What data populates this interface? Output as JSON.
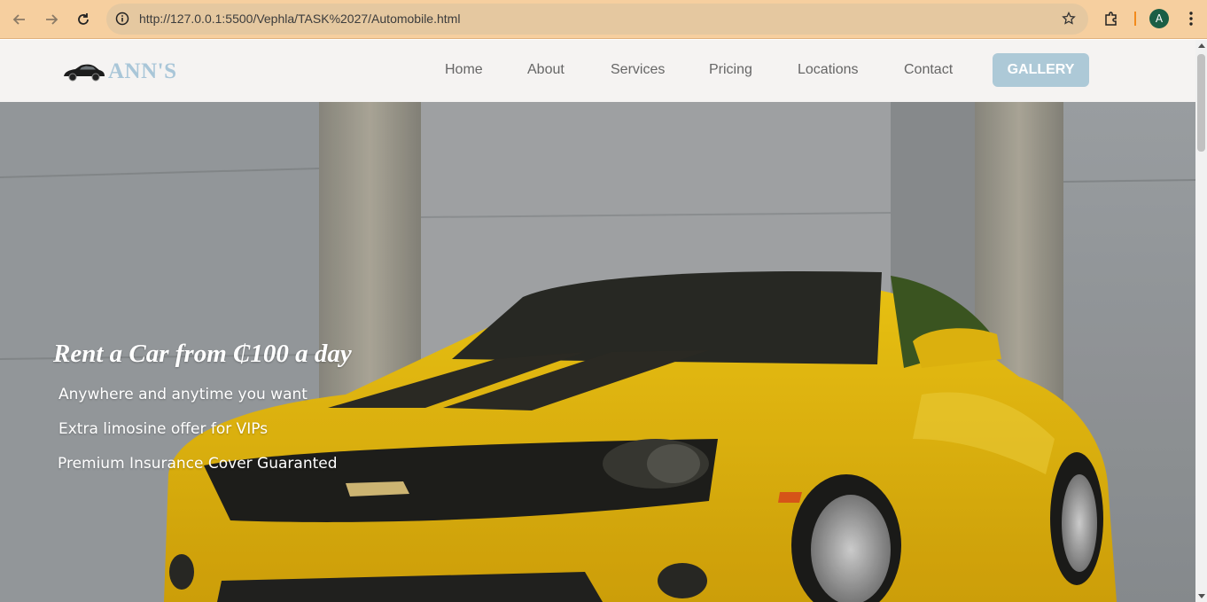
{
  "browser": {
    "url": "http://127.0.0.1:5500/Vephla/TASK%2027/Automobile.html",
    "profile_initial": "A",
    "icons": [
      "back-icon",
      "forward-icon",
      "reload-icon",
      "info-icon",
      "star-icon",
      "extensions-icon",
      "menu-icon"
    ]
  },
  "site": {
    "logo_text": "ANN'S",
    "nav": [
      {
        "label": "Home"
      },
      {
        "label": "About"
      },
      {
        "label": "Services"
      },
      {
        "label": "Pricing"
      },
      {
        "label": "Locations"
      },
      {
        "label": "Contact"
      }
    ],
    "gallery_label": "GALLERY"
  },
  "hero": {
    "title": "Rent a Car from ₵100 a day",
    "lines": [
      "Anywhere and anytime you want",
      "Extra limosine offer for VIPs",
      "Premium Insurance Cover Guaranted"
    ]
  },
  "colors": {
    "chrome": "#f6cf9f",
    "accent": "#adc9d7",
    "logo": "#a9c6d8",
    "car": "#f2c20e"
  }
}
